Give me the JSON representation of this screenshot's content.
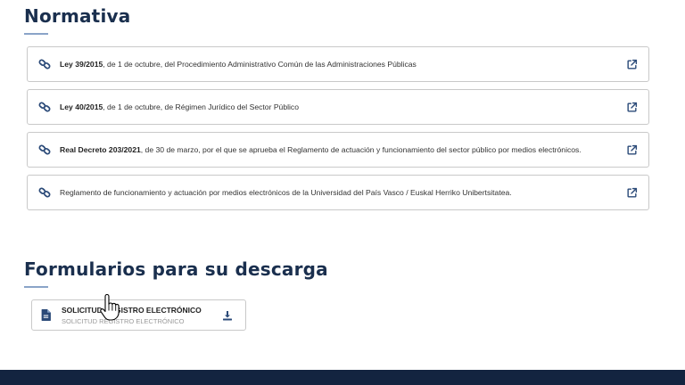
{
  "normativa": {
    "title": "Normativa",
    "items": [
      {
        "bold": "Ley 39/2015",
        "text": ", de 1 de octubre, del Procedimiento Administrativo Común de las Administraciones Públicas"
      },
      {
        "bold": "Ley 40/2015",
        "text": ", de 1 de octubre, de Régimen Jurídico del Sector Público"
      },
      {
        "bold": "Real Decreto 203/2021",
        "text": ", de 30 de marzo, por el que se aprueba el Reglamento de actuación y funcionamiento del sector público por medios electrónicos."
      },
      {
        "bold": "",
        "text": "Reglamento de funcionamiento y actuación por medios electrónicos de la Universidad del País Vasco / Euskal Herriko Unibertsitatea."
      }
    ]
  },
  "formularios": {
    "title": "Formularios para su descarga",
    "items": [
      {
        "title": "SOLICITUD REGISTRO ELECTRÓNICO",
        "subtitle": "SOLICITUD REGISTRO ELECTRÓNICO"
      }
    ]
  },
  "colors": {
    "title": "#1a2f4e",
    "accent": "#2b4a78",
    "underline": "#8aa4c8",
    "footer": "#132440"
  },
  "icons": {
    "law_link": "link-icon",
    "law_external": "external-link-icon",
    "form_doc": "document-icon",
    "form_download": "download-icon",
    "pointer": "hand-cursor-icon"
  }
}
